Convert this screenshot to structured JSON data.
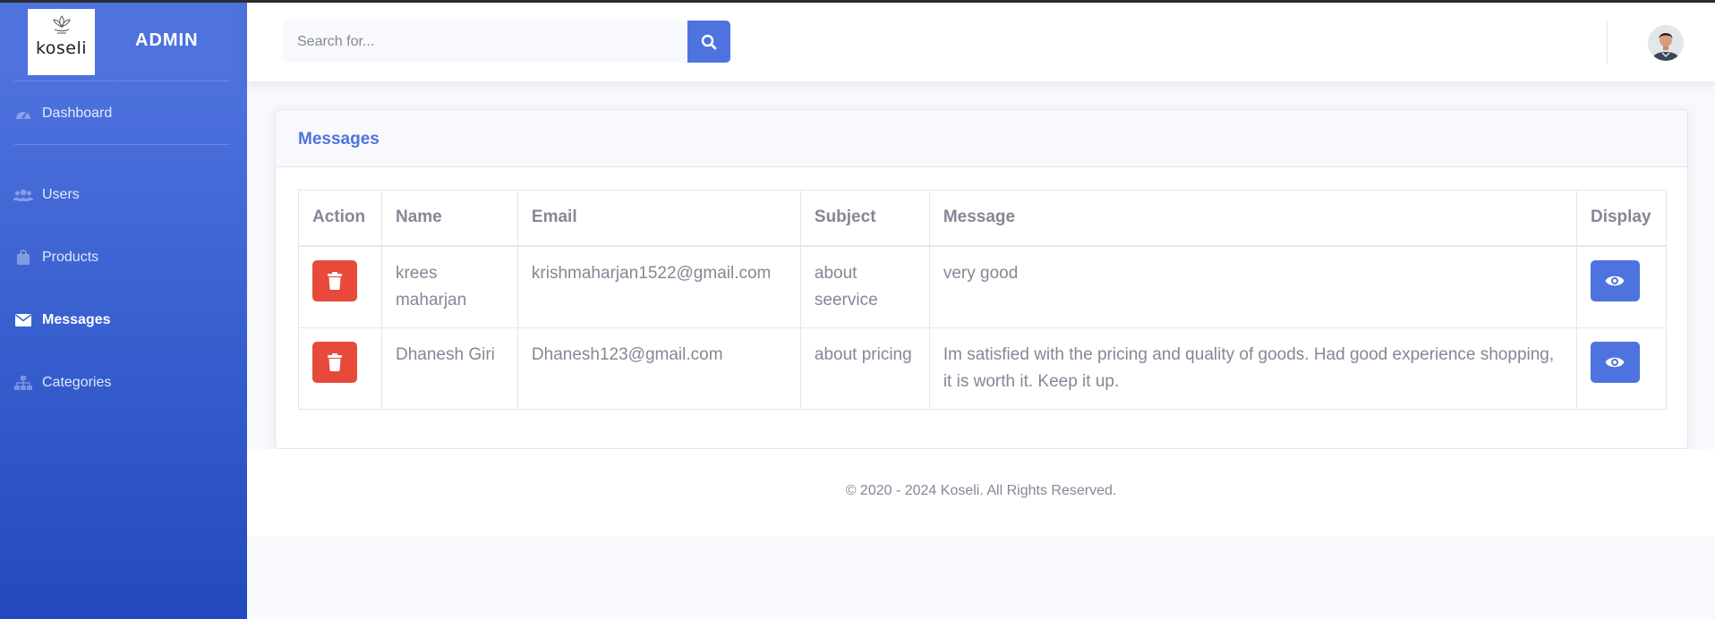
{
  "brand": {
    "logo_text": "koseli",
    "title": "ADMIN"
  },
  "sidebar": {
    "items": [
      {
        "label": "Dashboard",
        "icon": "tachometer-icon",
        "active": false
      },
      {
        "label": "Users",
        "icon": "users-icon",
        "active": false
      },
      {
        "label": "Products",
        "icon": "shopping-bag-icon",
        "active": false
      },
      {
        "label": "Messages",
        "icon": "envelope-icon",
        "active": true
      },
      {
        "label": "Categories",
        "icon": "sitemap-icon",
        "active": false
      }
    ]
  },
  "topbar": {
    "search_placeholder": "Search for...",
    "search_icon": "search-icon",
    "avatar_icon": "user-avatar"
  },
  "messages": {
    "title": "Messages",
    "columns": [
      "Action",
      "Name",
      "Email",
      "Subject",
      "Message",
      "Display"
    ],
    "rows": [
      {
        "name": "krees maharjan",
        "email": "krishmaharjan1522@gmail.com",
        "subject": "about seervice",
        "message": "very good"
      },
      {
        "name": "Dhanesh Giri",
        "email": "Dhanesh123@gmail.com",
        "subject": "about pricing",
        "message": "Im satisfied with the pricing and quality of goods. Had good experience shopping, it is worth it. Keep it up."
      }
    ]
  },
  "footer": {
    "text": "© 2020 - 2024 Koseli. All Rights Reserved."
  },
  "colors": {
    "primary": "#4e73df",
    "danger": "#e74a3b",
    "text_muted": "#858796"
  }
}
